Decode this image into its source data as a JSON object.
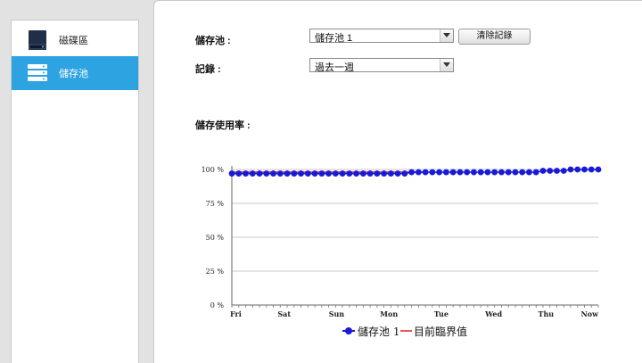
{
  "sidebar": {
    "items": [
      {
        "label": "磁碟區",
        "icon": "disk-volume-icon",
        "selected": false
      },
      {
        "label": "儲存池",
        "icon": "storage-pool-icon",
        "selected": true
      }
    ],
    "accent": "#2ea3e1"
  },
  "form": {
    "pool_label": "儲存池 :",
    "pool_value": "儲存池 1",
    "clear_button": "清除記錄",
    "record_label": "記錄 :",
    "record_value": "過去一週"
  },
  "chart_title": "儲存使用率 :",
  "chart_data": {
    "type": "line",
    "x_ticks": [
      "Fri",
      "Sat",
      "Sun",
      "Mon",
      "Tue",
      "Wed",
      "Thu",
      "Now"
    ],
    "y_ticks": [
      "100 %",
      "75 %",
      "50 %",
      "25 %",
      "0 %"
    ],
    "ylim": [
      0,
      100
    ],
    "grid": true,
    "series": [
      {
        "name": "儲存池 1",
        "color": "#1a1ad6",
        "values": [
          97,
          97,
          97,
          97,
          97,
          97,
          97,
          97,
          97,
          97,
          97,
          97,
          97,
          97,
          97,
          97,
          97,
          97,
          97,
          97,
          97,
          97,
          97,
          97,
          97,
          97,
          98,
          98,
          98,
          98,
          98,
          98,
          98,
          98,
          98,
          98,
          98,
          98,
          98,
          98,
          98,
          98,
          98,
          98,
          98,
          99,
          99,
          99,
          99,
          100,
          100,
          100,
          100,
          100
        ]
      },
      {
        "name": "目前臨界值",
        "color": "#e05a5a",
        "values": [
          98,
          98
        ]
      }
    ],
    "legend_position": "bottom-center"
  },
  "legend": {
    "series_label": "儲存池 1",
    "threshold_label": "目前臨界值"
  }
}
